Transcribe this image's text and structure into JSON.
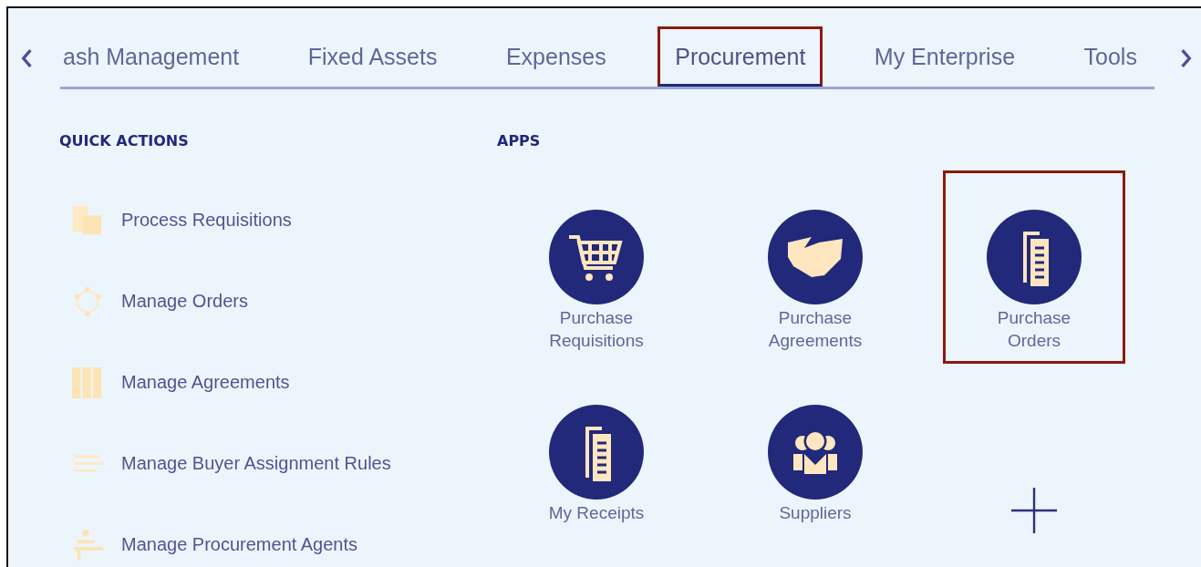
{
  "tabs": [
    {
      "label": "ash Management",
      "selected": false,
      "highlighted": false
    },
    {
      "label": "Fixed Assets",
      "selected": false,
      "highlighted": false
    },
    {
      "label": "Expenses",
      "selected": false,
      "highlighted": false
    },
    {
      "label": "Procurement",
      "selected": true,
      "highlighted": true
    },
    {
      "label": "My Enterprise",
      "selected": false,
      "highlighted": false
    },
    {
      "label": "Tools",
      "selected": false,
      "highlighted": false
    }
  ],
  "quick_actions": {
    "title": "QUICK ACTIONS",
    "items": [
      {
        "kind": "requisitions",
        "label": "Process Requisitions"
      },
      {
        "kind": "orders",
        "label": "Manage Orders"
      },
      {
        "kind": "agreements",
        "label": "Manage Agreements"
      },
      {
        "kind": "rules",
        "label": "Manage Buyer Assignment Rules"
      },
      {
        "kind": "agents",
        "label": "Manage Procurement Agents"
      }
    ]
  },
  "apps": {
    "title": "APPS",
    "items": [
      {
        "kind": "cart",
        "label": "Purchase Requisitions",
        "highlighted": false
      },
      {
        "kind": "handshake",
        "label": "Purchase Agreements",
        "highlighted": false
      },
      {
        "kind": "document",
        "label": "Purchase Orders",
        "highlighted": true
      },
      {
        "kind": "document",
        "label": "My Receipts",
        "highlighted": false
      },
      {
        "kind": "people",
        "label": "Suppliers",
        "highlighted": false
      },
      {
        "kind": "add",
        "highlighted": false
      }
    ]
  }
}
